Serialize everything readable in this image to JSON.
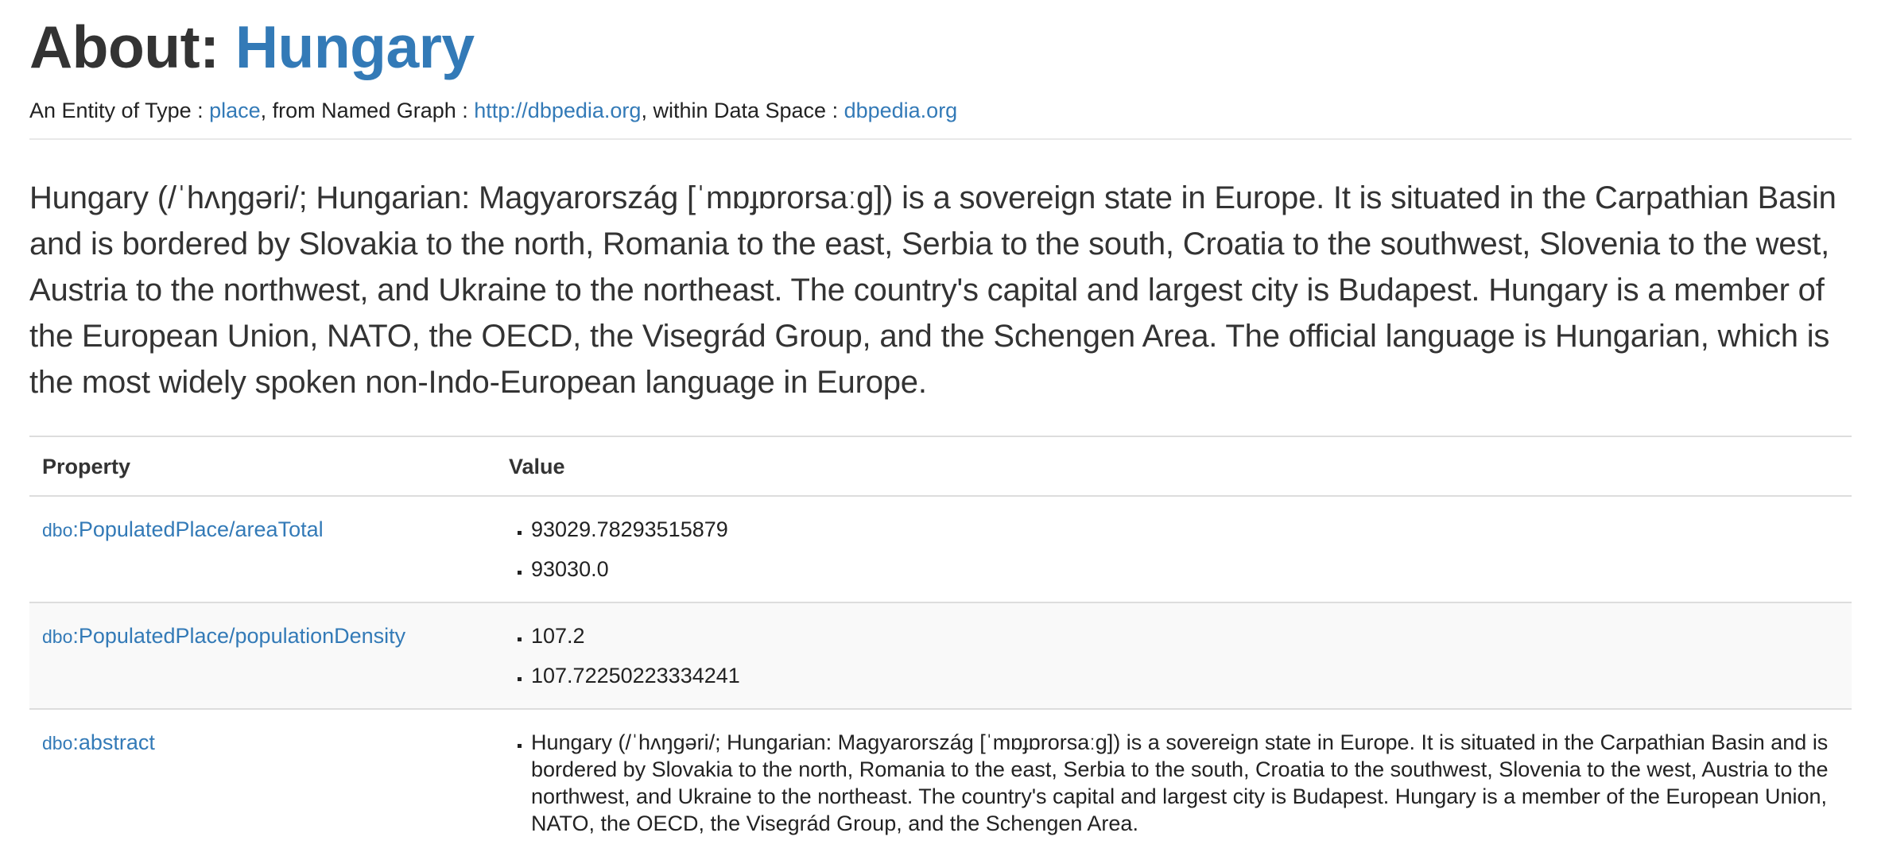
{
  "header": {
    "title_prefix": "About: ",
    "entity": "Hungary"
  },
  "subtitle": {
    "text1": "An Entity of Type : ",
    "type_link": "place",
    "text2": ", from Named Graph : ",
    "graph_link": "http://dbpedia.org",
    "text3": ", within Data Space : ",
    "space_link": "dbpedia.org"
  },
  "description": "Hungary (/ˈhʌŋɡəri/; Hungarian: Magyarország [ˈmɒɟɒrorsaːɡ]) is a sovereign state in Europe. It is situated in the Carpathian Basin and is bordered by Slovakia to the north, Romania to the east, Serbia to the south, Croatia to the southwest, Slovenia to the west, Austria to the northwest, and Ukraine to the northeast. The country's capital and largest city is Budapest. Hungary is a member of the European Union, NATO, the OECD, the Visegrád Group, and the Schengen Area. The official language is Hungarian, which is the most widely spoken non-Indo-European language in Europe.",
  "table": {
    "headers": [
      "Property",
      "Value"
    ],
    "rows": [
      {
        "prefix": "dbo",
        "property": ":PopulatedPlace/areaTotal",
        "values": [
          "93029.78293515879",
          "93030.0"
        ]
      },
      {
        "prefix": "dbo",
        "property": ":PopulatedPlace/populationDensity",
        "values": [
          "107.2",
          "107.72250223334241"
        ]
      },
      {
        "prefix": "dbo",
        "property": ":abstract",
        "values": [
          "Hungary (/ˈhʌŋɡəri/; Hungarian: Magyarország [ˈmɒɟɒrorsaːɡ]) is a sovereign state in Europe. It is situated in the Carpathian Basin and is bordered by Slovakia to the north, Romania to the east, Serbia to the south, Croatia to the southwest, Slovenia to the west, Austria to the northwest, and Ukraine to the northeast. The country's capital and largest city is Budapest. Hungary is a member of the European Union, NATO, the OECD, the Visegrád Group, and the Schengen Area."
        ]
      }
    ]
  },
  "colors": {
    "link": "#337ab7",
    "text": "#333333",
    "row_alt": "#f9f9f9",
    "border": "#dddddd"
  }
}
